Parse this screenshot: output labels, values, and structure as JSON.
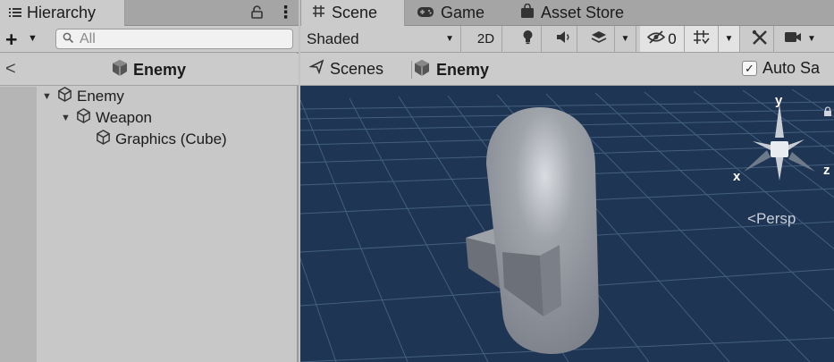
{
  "hierarchy": {
    "tab_label": "Hierarchy",
    "search_placeholder": "All",
    "breadcrumb_title": "Enemy",
    "tree": [
      {
        "label": "Enemy",
        "depth": 0,
        "expanded": true
      },
      {
        "label": "Weapon",
        "depth": 1,
        "expanded": true
      },
      {
        "label": "Graphics (Cube)",
        "depth": 2,
        "expanded": false
      }
    ]
  },
  "scene": {
    "tabs": [
      {
        "label": "Scene",
        "icon": "grid-icon",
        "active": true
      },
      {
        "label": "Game",
        "icon": "gamepad-icon",
        "active": false
      },
      {
        "label": "Asset Store",
        "icon": "shopping-bag-icon",
        "active": false
      }
    ],
    "draw_mode": "Shaded",
    "toolbar": {
      "mode_2d": "2D",
      "hidden_count": "0"
    },
    "breadcrumb": {
      "scenes_label": "Scenes",
      "prefab_label": "Enemy",
      "autosave_label": "Auto Sa",
      "autosave_checked": true
    },
    "gizmo": {
      "y_label": "y",
      "x_label": "x",
      "z_label": "z",
      "projection_label": "Persp"
    }
  },
  "colors": {
    "viewport_bg": "#1e3554",
    "panel_bg": "#cbcbcb",
    "tab_bar_bg": "#a5a5a5",
    "capsule": "#8e939c"
  }
}
